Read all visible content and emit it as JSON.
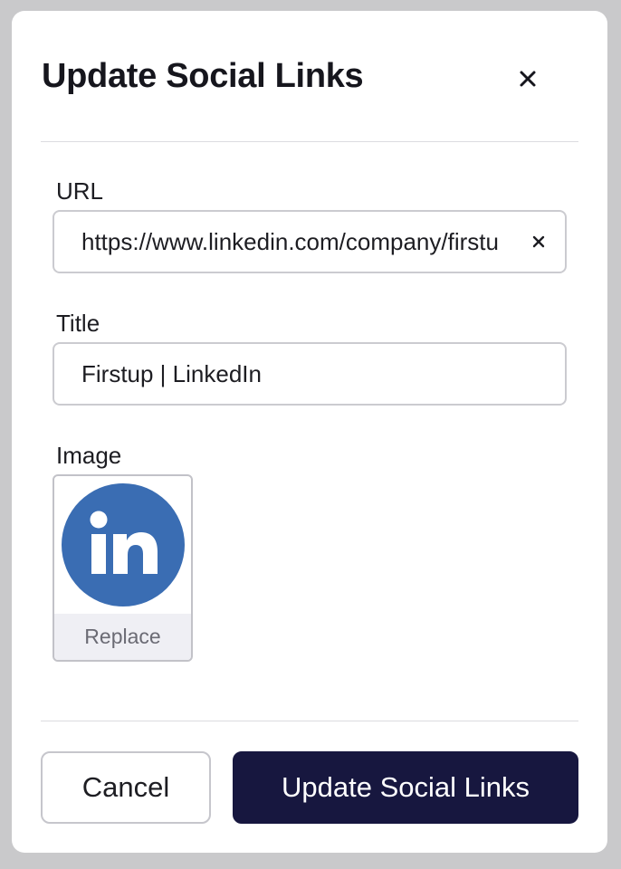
{
  "modal": {
    "title": "Update Social Links",
    "close_icon": "close-icon"
  },
  "form": {
    "url": {
      "label": "URL",
      "value": "https://www.linkedin.com/company/firstup",
      "clear_icon": "close-icon"
    },
    "title": {
      "label": "Title",
      "value": "Firstup | LinkedIn"
    },
    "image": {
      "label": "Image",
      "logo_icon": "linkedin-icon",
      "logo_text": "in",
      "logo_color": "#3a6db3",
      "replace_label": "Replace"
    }
  },
  "footer": {
    "cancel_label": "Cancel",
    "submit_label": "Update Social Links"
  },
  "colors": {
    "primary": "#17173f",
    "backdrop": "#c9c9cb",
    "replace_bg": "#efeff4"
  }
}
